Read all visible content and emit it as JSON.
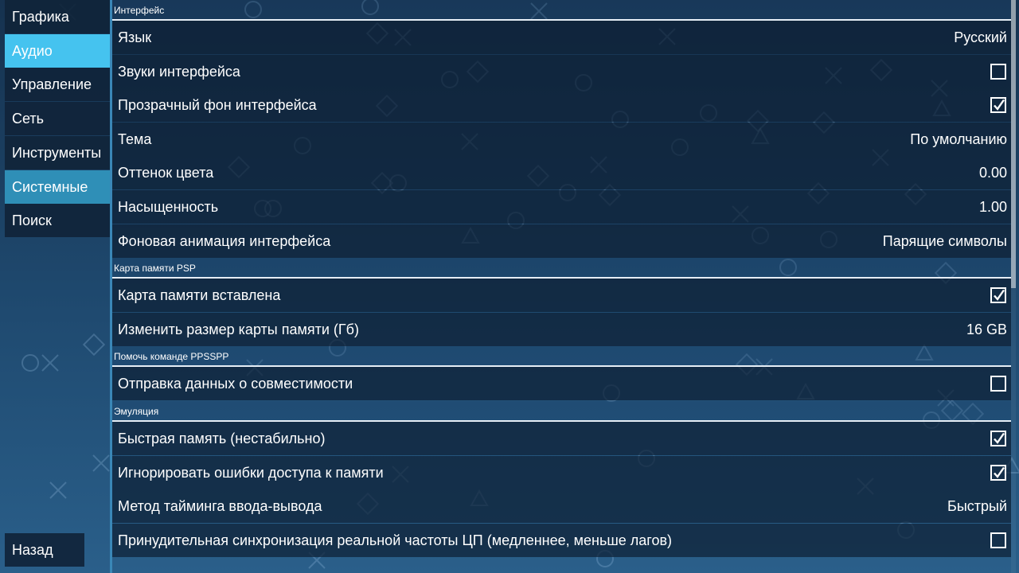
{
  "sidebar": {
    "items": [
      {
        "label": "Графика",
        "state": "normal"
      },
      {
        "label": "Аудио",
        "state": "selected"
      },
      {
        "label": "Управление",
        "state": "normal"
      },
      {
        "label": "Сеть",
        "state": "normal"
      },
      {
        "label": "Инструменты",
        "state": "normal"
      },
      {
        "label": "Системные",
        "state": "highlight"
      },
      {
        "label": "Поиск",
        "state": "normal"
      }
    ],
    "back_label": "Назад"
  },
  "sections": [
    {
      "title": "Интерфейс",
      "rows": [
        {
          "label": "Язык",
          "type": "value",
          "value": "Русский"
        },
        {
          "label": "Звуки интерфейса",
          "type": "checkbox",
          "checked": false
        },
        {
          "label": "Прозрачный фон интерфейса",
          "type": "checkbox",
          "checked": true
        },
        {
          "label": "Тема",
          "type": "value",
          "value": "По умолчанию"
        },
        {
          "label": "Оттенок цвета",
          "type": "value",
          "value": "0.00"
        },
        {
          "label": "Насыщенность",
          "type": "value",
          "value": "1.00"
        },
        {
          "label": "Фоновая анимация интерфейса",
          "type": "value",
          "value": "Парящие символы"
        }
      ]
    },
    {
      "title": "Карта памяти PSP",
      "rows": [
        {
          "label": "Карта памяти вставлена",
          "type": "checkbox",
          "checked": true
        },
        {
          "label": "Изменить размер карты памяти (Гб)",
          "type": "value",
          "value": "16 GB"
        }
      ]
    },
    {
      "title": "Помочь команде PPSSPP",
      "rows": [
        {
          "label": "Отправка данных о совместимости",
          "type": "checkbox",
          "checked": false
        }
      ]
    },
    {
      "title": "Эмуляция",
      "rows": [
        {
          "label": "Быстрая память (нестабильно)",
          "type": "checkbox",
          "checked": true
        },
        {
          "label": "Игнорировать ошибки доступа к памяти",
          "type": "checkbox",
          "checked": true
        },
        {
          "label": "Метод тайминга ввода-вывода",
          "type": "value",
          "value": "Быстрый"
        },
        {
          "label": "Принудительная синхронизация реальной частоты ЦП (медленнее, меньше лагов)",
          "type": "checkbox",
          "checked": false
        }
      ]
    }
  ],
  "colors": {
    "selected": "#45c3ef",
    "highlight": "#2f8fb7",
    "row_bg": "#0e2034"
  }
}
